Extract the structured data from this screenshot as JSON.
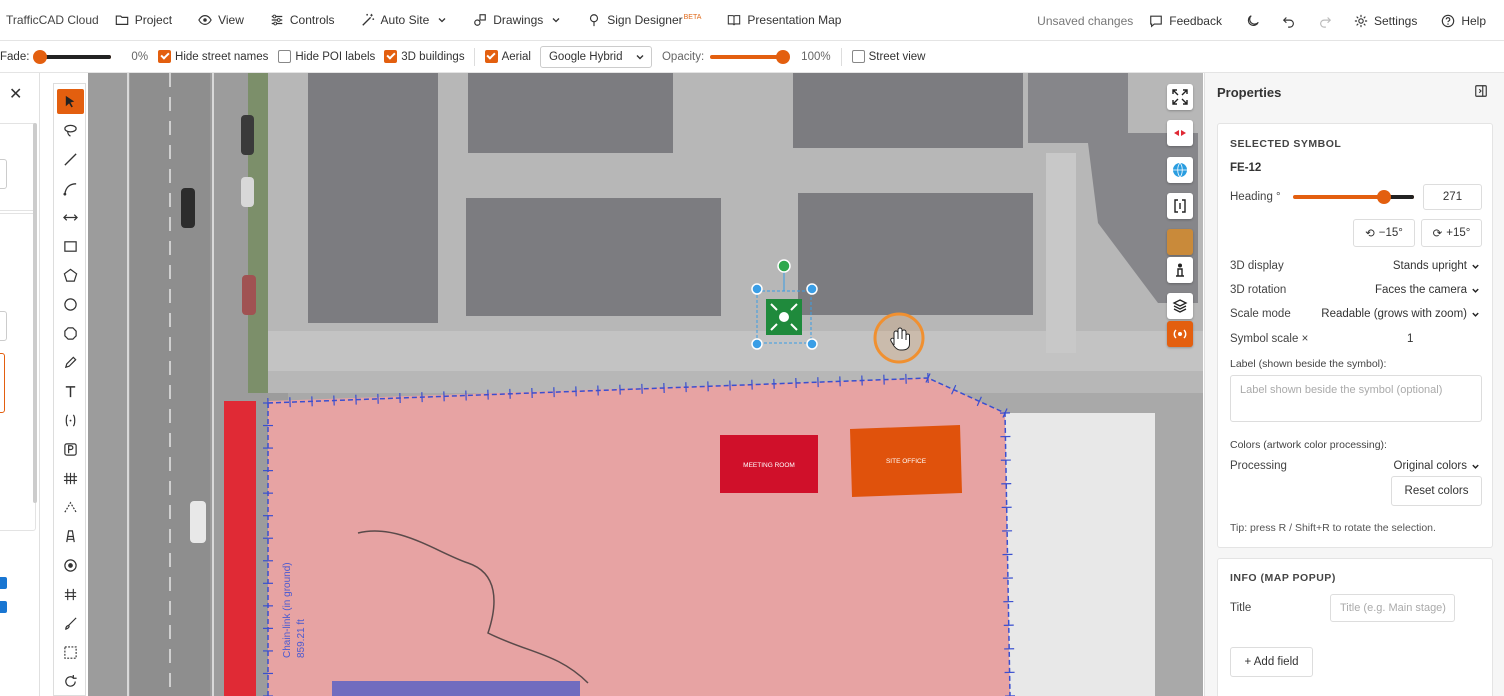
{
  "app": {
    "brand": "TrafficCAD Cloud"
  },
  "menu": [
    {
      "label": "Project",
      "icon": "folder-icon"
    },
    {
      "label": "View",
      "icon": "eye-icon"
    },
    {
      "label": "Controls",
      "icon": "sliders-icon"
    },
    {
      "label": "Auto Site",
      "icon": "magic-wand-icon"
    },
    {
      "label": "Drawings",
      "icon": "drawings-icon"
    },
    {
      "label": "Sign Designer",
      "icon": "sign-icon",
      "badge": "BETA"
    },
    {
      "label": "Presentation Map",
      "icon": "book-icon"
    }
  ],
  "topright": {
    "unsaved": "Unsaved changes",
    "feedback": "Feedback",
    "settings": "Settings",
    "help": "Help"
  },
  "toolbar": {
    "fade_label": "Fade:",
    "fade_value": "0%",
    "fade_fraction": 0.0,
    "hide_street_names": {
      "label": "Hide street names",
      "checked": true
    },
    "hide_poi_labels": {
      "label": "Hide POI labels",
      "checked": false
    },
    "buildings_3d": {
      "label": "3D buildings",
      "checked": true
    },
    "aerial": {
      "label": "Aerial",
      "checked": true
    },
    "basemap_selected": "Google Hybrid",
    "opacity_label": "Opacity:",
    "opacity_value": "100%",
    "opacity_fraction": 1.0,
    "street_view": {
      "label": "Street view",
      "checked": false
    }
  },
  "map": {
    "meeting_label": "MEETING ROOM",
    "site_label": "SITE OFFICE",
    "fence_label": "Chain-link (in ground)",
    "fence_length": "859.21 ft",
    "colors": {
      "zone": "#e8a0a0",
      "fence": "#3a4fd0",
      "meeting": "#d0102a",
      "site": "#e0520c",
      "symbol": "#1f8a3c"
    }
  },
  "properties": {
    "title": "Properties",
    "selected_symbol_header": "SELECTED SYMBOL",
    "symbol_id": "FE-12",
    "heading_label": "Heading °",
    "heading_value": "271",
    "heading_fraction": 0.75,
    "rotate_minus": "−15°",
    "rotate_plus": "+15°",
    "display_3d_label": "3D display",
    "display_3d_value": "Stands upright",
    "rotation_3d_label": "3D rotation",
    "rotation_3d_value": "Faces the camera",
    "scale_mode_label": "Scale mode",
    "scale_mode_value": "Readable (grows with zoom)",
    "symbol_scale_label": "Symbol scale ×",
    "symbol_scale_value": "1",
    "label_field_label": "Label (shown beside the symbol):",
    "label_placeholder": "Label shown beside the symbol (optional)",
    "colors_label": "Colors (artwork color processing):",
    "processing_label": "Processing",
    "processing_value": "Original colors",
    "reset_colors": "Reset colors",
    "tip": "Tip: press R / Shift+R to rotate the selection.",
    "info_header": "INFO (MAP POPUP)",
    "info_title_label": "Title",
    "info_title_placeholder": "Title (e.g. Main stage)",
    "add_field": "+ Add field"
  }
}
